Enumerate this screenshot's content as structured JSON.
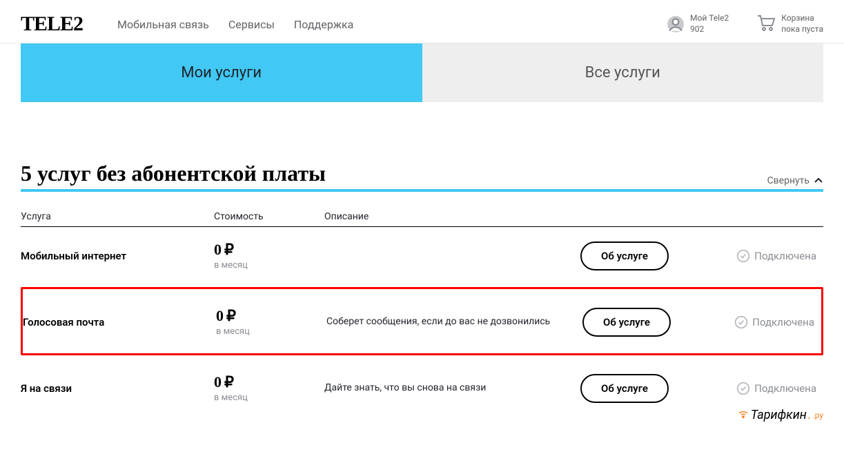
{
  "header": {
    "logo": "TELE2",
    "nav": [
      "Мобильная связь",
      "Сервисы",
      "Поддержка"
    ],
    "account_label": "Мой Tele2",
    "account_number": "902",
    "cart_label": "Корзина",
    "cart_status": "пока пуста"
  },
  "tabs": {
    "active": "Мои услуги",
    "inactive": "Все услуги"
  },
  "section": {
    "title": "5 услуг без абонентской платы",
    "collapse_label": "Свернуть"
  },
  "columns": {
    "service": "Услуга",
    "cost": "Стоимость",
    "desc": "Описание"
  },
  "rows": [
    {
      "name": "Мобильный интернет",
      "price": "0",
      "currency": "₽",
      "period": "в месяц",
      "desc": "",
      "button": "Об услуге",
      "status": "Подключена",
      "highlight": false
    },
    {
      "name": "Голосовая почта",
      "price": "0",
      "currency": "₽",
      "period": "в месяц",
      "desc": "Соберет сообщения, если до вас не дозвонились",
      "button": "Об услуге",
      "status": "Подключена",
      "highlight": true
    },
    {
      "name": "Я на связи",
      "price": "0",
      "currency": "₽",
      "period": "в месяц",
      "desc": "Дайте знать, что вы снова на связи",
      "button": "Об услуге",
      "status": "Подключена",
      "highlight": false
    }
  ],
  "watermark": {
    "text": "Тарифкин",
    "suffix": ".ру"
  }
}
